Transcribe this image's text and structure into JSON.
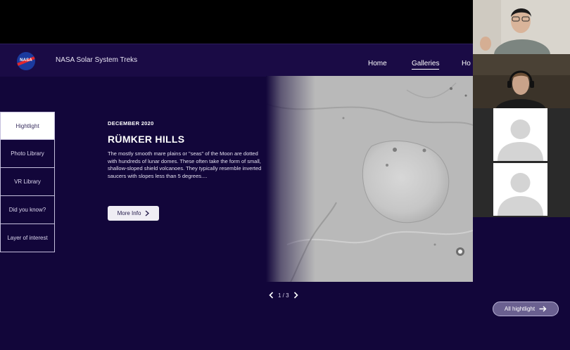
{
  "header": {
    "brand": "NASA Solar System Treks",
    "logo_text": "NASA",
    "nav": [
      {
        "label": "Home"
      },
      {
        "label": "Galleries",
        "active": true
      },
      {
        "label": "Ho"
      }
    ]
  },
  "side_tabs": [
    {
      "label": "Hightlight",
      "active": true
    },
    {
      "label": "Photo Library"
    },
    {
      "label": "VR  Library"
    },
    {
      "label": "Did you know?"
    },
    {
      "label": "Layer of interest"
    }
  ],
  "feature": {
    "date": "DECEMBER 2020",
    "title": "RÜMKER HILLS",
    "description": "The mostly smooth mare plains or \"seas\" of the Moon are dotted with hundreds of lunar domes. These often take the form of small, shallow-sloped shield volcanoes. They typically resemble inverted saucers with slopes less than 5 degrees....",
    "more_label": "More Info"
  },
  "pager": {
    "text": "1 / 3"
  },
  "all_label": "All hightlight",
  "icons": {
    "prev": "chevron-left-icon",
    "next": "chevron-right-icon",
    "more": "chevron-right-icon",
    "all": "arrow-right-icon",
    "participant": "person-placeholder-icon"
  }
}
